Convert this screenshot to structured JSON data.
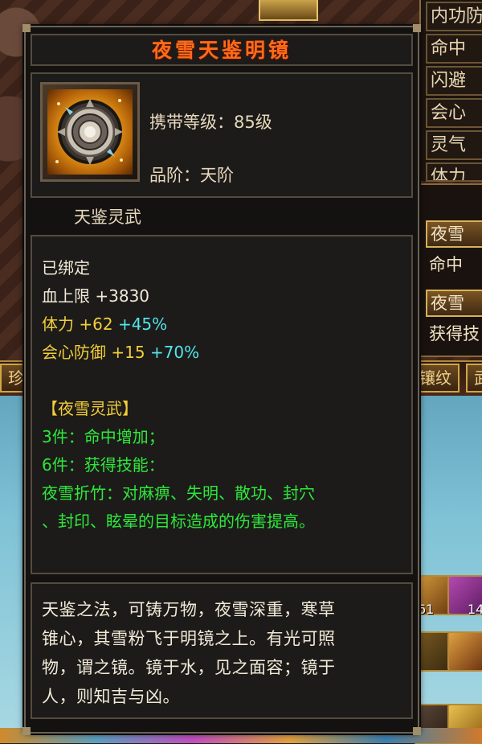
{
  "item": {
    "name": "夜雪天鉴明镜",
    "level_label": "携带等级：85级",
    "grade_label": "品阶：天阶",
    "category": "天鉴灵武",
    "icon": "mirror-shield-icon"
  },
  "attributes": {
    "bound": "已绑定",
    "rows": [
      {
        "label": "血上限",
        "value": "+3830",
        "bonus": ""
      },
      {
        "label": "体力",
        "value": "+62",
        "bonus": "+45%"
      },
      {
        "label": "会心防御",
        "value": "+15",
        "bonus": "+70%"
      }
    ]
  },
  "set": {
    "name": "【夜雪灵武】",
    "piece3": "3件：命中增加；",
    "piece6": "6件：获得技能：",
    "skill_line1": "夜雪折竹：对麻痹、失明、散功、封穴",
    "skill_line2": "、封印、眩晕的目标造成的伤害提高。"
  },
  "description": {
    "line1": "天鉴之法，可铸万物，夜雪深重，寒草",
    "line2": "锥心，其雪粉飞于明镜之上。有光可照",
    "line3": "物，谓之镜。镜于水，见之面容；镜于",
    "line4": "人，则知吉与凶。"
  },
  "background": {
    "stats": [
      "内功防",
      "命中",
      "闪避",
      "会心",
      "灵气",
      "体力"
    ],
    "bars": [
      "夜雪",
      "命中",
      "夜雪",
      "获得技"
    ],
    "tabs": [
      "珍",
      "镶纹",
      "武"
    ],
    "slot_numbers": [
      "61",
      "14"
    ],
    "colors": {
      "title": "#ff6a1a",
      "gold": "#f2ce3a",
      "cyan": "#52e6ec",
      "green": "#2ee83c",
      "text": "#f2e9d8"
    }
  }
}
